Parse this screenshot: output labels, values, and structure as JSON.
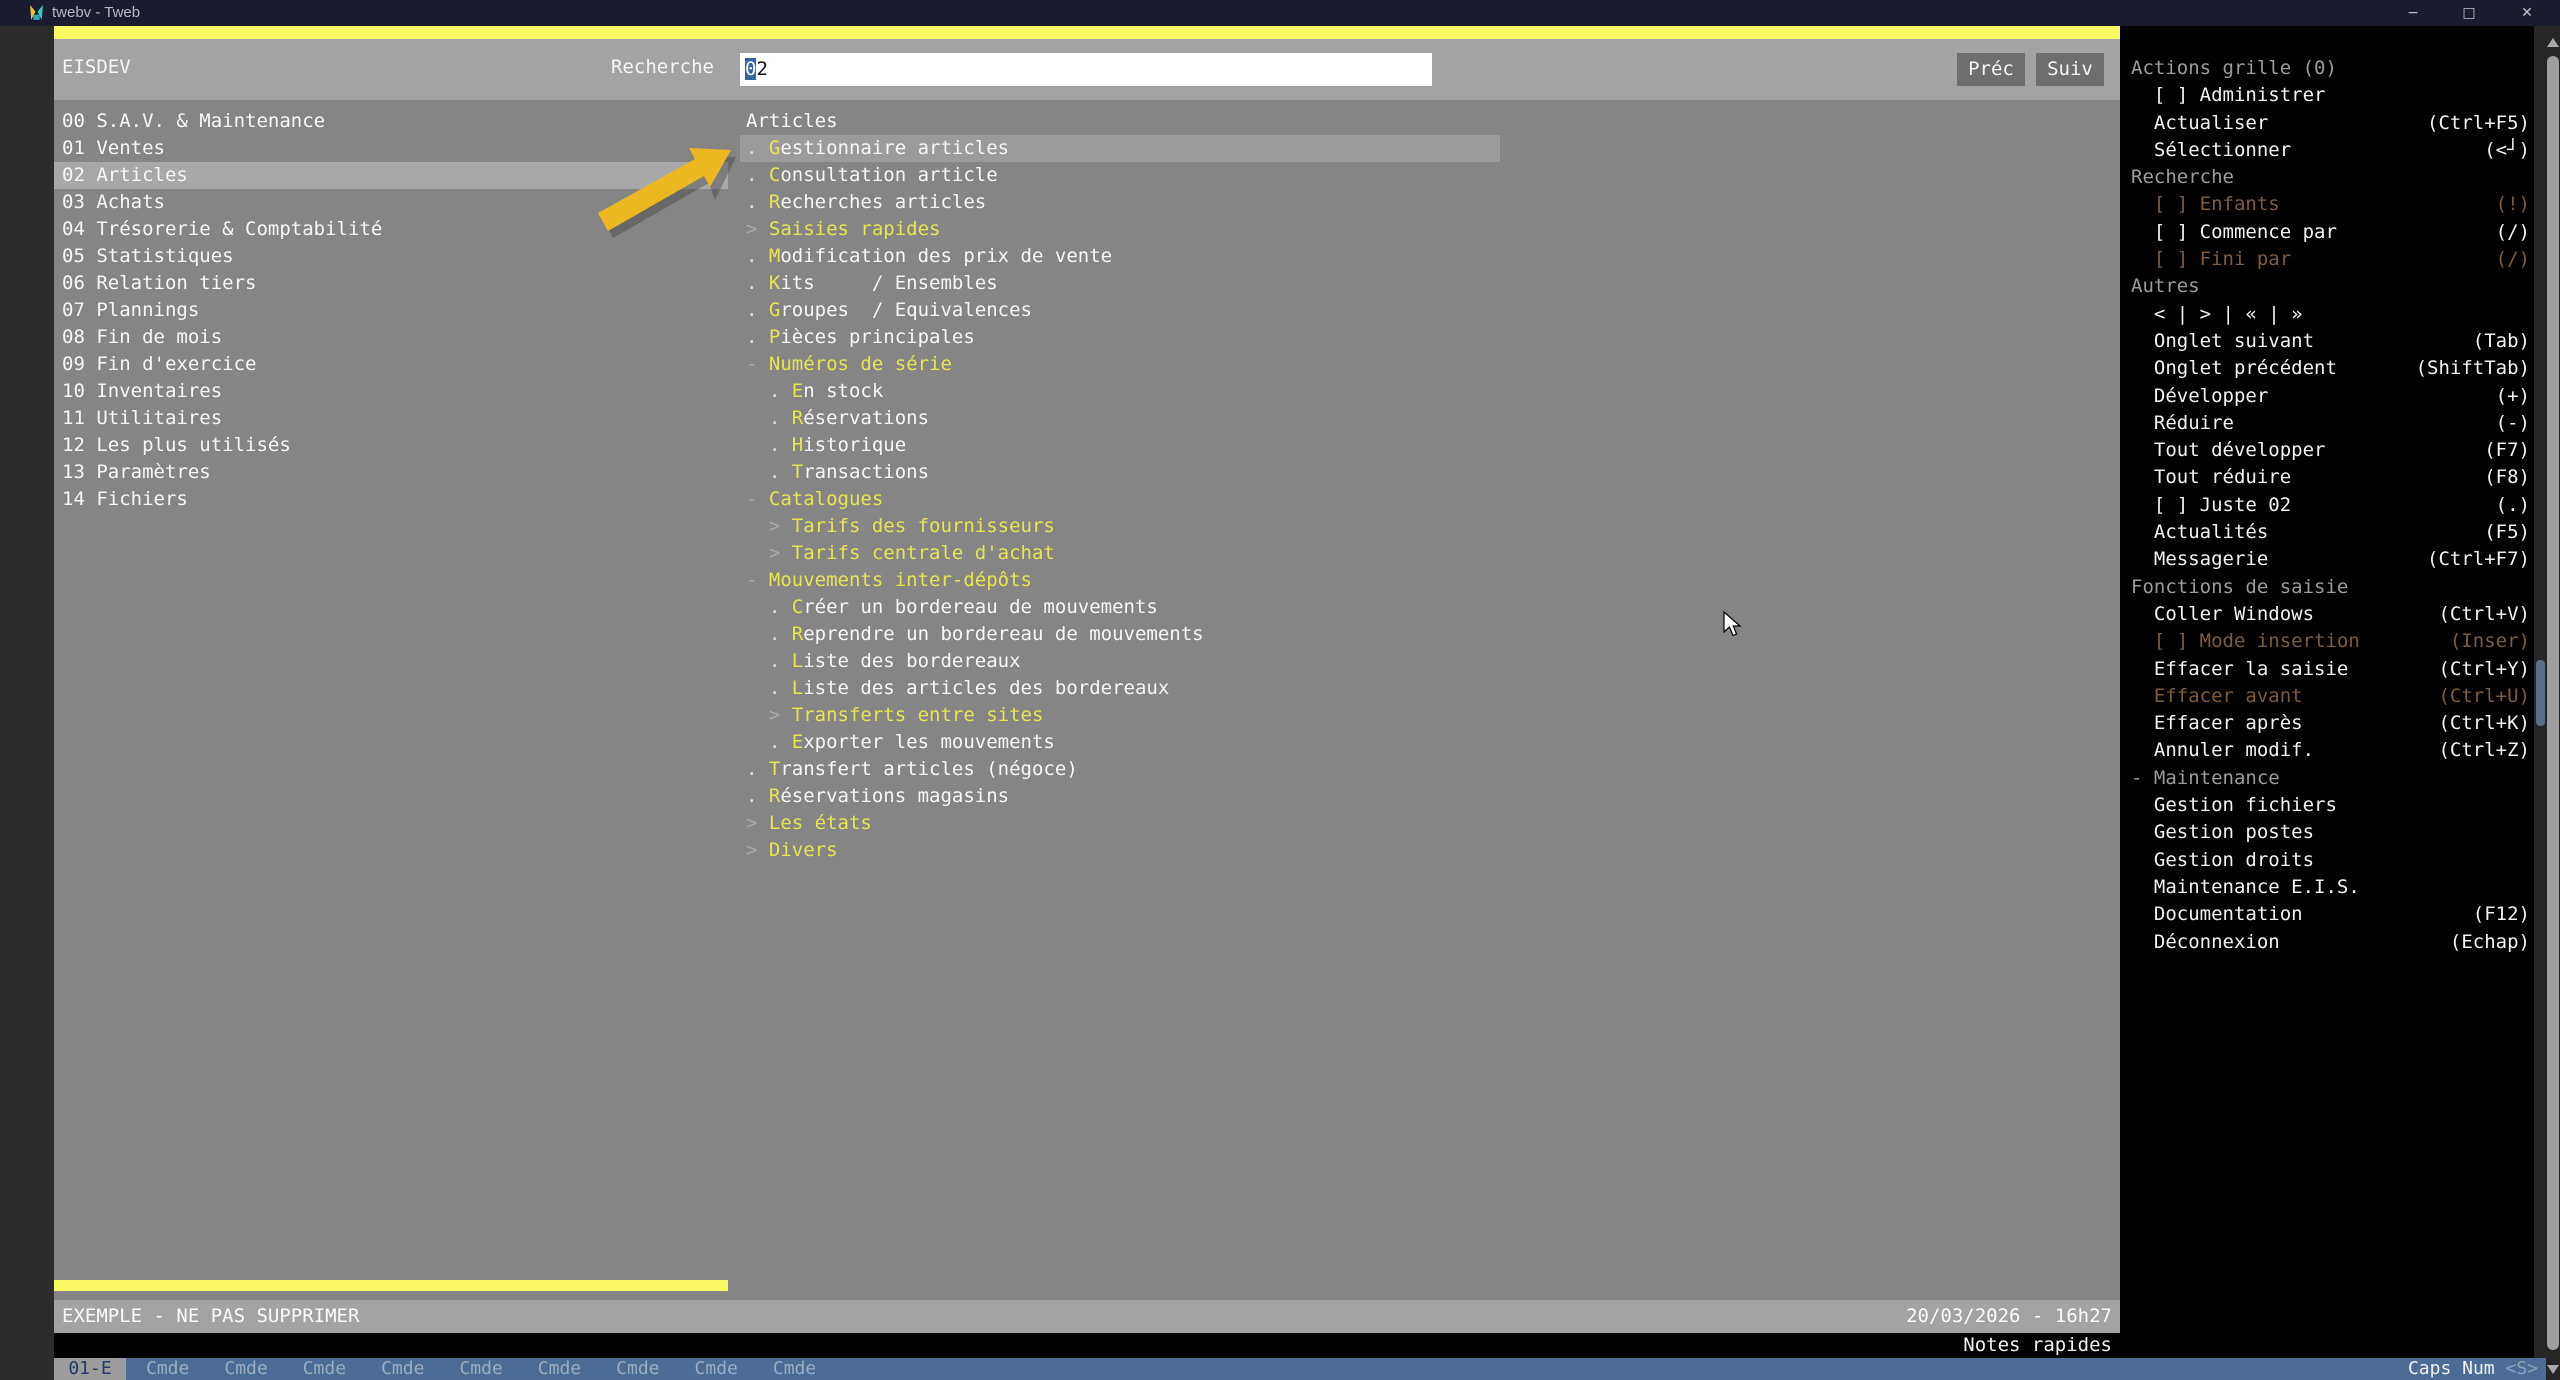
{
  "window": {
    "title": "twebv - Tweb",
    "controls": {
      "minimize": "−",
      "maximize": "□",
      "close": "✕"
    }
  },
  "colors": {
    "accent_yellow": "#f9f964",
    "menu_hotkey_yellow": "#e9e550",
    "selection_blue": "#3465a4",
    "tabbar_blue": "#4a6c96",
    "dim_brown": "#7e5c3f",
    "arrow_gold": "#ecb822",
    "sidebar_bg": "#000000"
  },
  "topbar": {
    "session": "EISDEV",
    "search_label": "Recherche",
    "search_selected": "0",
    "search_rest": "2",
    "prev_label": "Préc",
    "next_label": "Suiv"
  },
  "left_menu": {
    "items": [
      {
        "code": "00",
        "label": "S.A.V. & Maintenance",
        "selected": false
      },
      {
        "code": "01",
        "label": "Ventes",
        "selected": false
      },
      {
        "code": "02",
        "label": "Articles",
        "selected": true
      },
      {
        "code": "03",
        "label": "Achats",
        "selected": false
      },
      {
        "code": "04",
        "label": "Trésorerie & Comptabilité",
        "selected": false
      },
      {
        "code": "05",
        "label": "Statistiques",
        "selected": false
      },
      {
        "code": "06",
        "label": "Relation tiers",
        "selected": false
      },
      {
        "code": "07",
        "label": "Plannings",
        "selected": false
      },
      {
        "code": "08",
        "label": "Fin de mois",
        "selected": false
      },
      {
        "code": "09",
        "label": "Fin d'exercice",
        "selected": false
      },
      {
        "code": "10",
        "label": "Inventaires",
        "selected": false
      },
      {
        "code": "11",
        "label": "Utilitaires",
        "selected": false
      },
      {
        "code": "12",
        "label": "Les plus utilisés",
        "selected": false
      },
      {
        "code": "13",
        "label": "Paramètres",
        "selected": false
      },
      {
        "code": "14",
        "label": "Fichiers",
        "selected": false
      }
    ]
  },
  "articles_menu": {
    "title": "Articles",
    "items": [
      {
        "indent": 0,
        "prefix": ".",
        "label": "Gestionnaire articles",
        "hl": "first",
        "selected": true
      },
      {
        "indent": 0,
        "prefix": ".",
        "label": "Consultation article",
        "hl": "first",
        "selected": false
      },
      {
        "indent": 0,
        "prefix": ".",
        "label": "Recherches articles",
        "hl": "first",
        "selected": false
      },
      {
        "indent": 0,
        "prefix": ">",
        "label": "Saisies rapides",
        "hl": "all",
        "selected": false
      },
      {
        "indent": 0,
        "prefix": ".",
        "label": "Modification des prix de vente",
        "hl": "first",
        "selected": false
      },
      {
        "indent": 0,
        "prefix": ".",
        "label": "Kits     / Ensembles",
        "hl": "first",
        "selected": false
      },
      {
        "indent": 0,
        "prefix": ".",
        "label": "Groupes  / Equivalences",
        "hl": "first",
        "selected": false
      },
      {
        "indent": 0,
        "prefix": ".",
        "label": "Pièces principales",
        "hl": "first",
        "selected": false
      },
      {
        "indent": 0,
        "prefix": "-",
        "label": "Numéros de série",
        "hl": "all",
        "selected": false
      },
      {
        "indent": 1,
        "prefix": ".",
        "label": "En stock",
        "hl": "first",
        "selected": false
      },
      {
        "indent": 1,
        "prefix": ".",
        "label": "Réservations",
        "hl": "first",
        "selected": false
      },
      {
        "indent": 1,
        "prefix": ".",
        "label": "Historique",
        "hl": "first",
        "selected": false
      },
      {
        "indent": 1,
        "prefix": ".",
        "label": "Transactions",
        "hl": "first",
        "selected": false
      },
      {
        "indent": 0,
        "prefix": "-",
        "label": "Catalogues",
        "hl": "all",
        "selected": false
      },
      {
        "indent": 1,
        "prefix": ">",
        "label": "Tarifs des fournisseurs",
        "hl": "all",
        "selected": false
      },
      {
        "indent": 1,
        "prefix": ">",
        "label": "Tarifs centrale d'achat",
        "hl": "all",
        "selected": false
      },
      {
        "indent": 0,
        "prefix": "-",
        "label": "Mouvements inter-dépôts",
        "hl": "all",
        "selected": false
      },
      {
        "indent": 1,
        "prefix": ".",
        "label": "Créer un bordereau de mouvements",
        "hl": "first",
        "selected": false
      },
      {
        "indent": 1,
        "prefix": ".",
        "label": "Reprendre un bordereau de mouvements",
        "hl": "first",
        "selected": false
      },
      {
        "indent": 1,
        "prefix": ".",
        "label": "Liste des bordereaux",
        "hl": "first",
        "selected": false
      },
      {
        "indent": 1,
        "prefix": ".",
        "label": "Liste des articles des bordereaux",
        "hl": "first",
        "selected": false
      },
      {
        "indent": 1,
        "prefix": ">",
        "label": "Transferts entre sites",
        "hl": "all",
        "selected": false
      },
      {
        "indent": 1,
        "prefix": ".",
        "label": "Exporter les mouvements",
        "hl": "first",
        "selected": false
      },
      {
        "indent": 0,
        "prefix": ".",
        "label": "Transfert articles (négoce)",
        "hl": "first",
        "selected": false
      },
      {
        "indent": 0,
        "prefix": ".",
        "label": "Réservations magasins",
        "hl": "first",
        "selected": false
      },
      {
        "indent": 0,
        "prefix": ">",
        "label": "Les états",
        "hl": "all",
        "selected": false
      },
      {
        "indent": 0,
        "prefix": ">",
        "label": "Divers",
        "hl": "all",
        "selected": false
      }
    ]
  },
  "sidebar": {
    "rows": [
      {
        "label": "Actions grille (0)",
        "shortcut": "",
        "style": "header"
      },
      {
        "label": "[ ] Administrer",
        "shortcut": "",
        "style": "normal"
      },
      {
        "label": "Actualiser",
        "shortcut": "(Ctrl+F5)",
        "style": "normal"
      },
      {
        "label": "Sélectionner",
        "shortcut": "(<┘)",
        "style": "normal"
      },
      {
        "label": "Recherche",
        "shortcut": "",
        "style": "header"
      },
      {
        "label": "[ ] Enfants",
        "shortcut": "(!)",
        "style": "dim"
      },
      {
        "label": "[ ] Commence par",
        "shortcut": "(/)",
        "style": "normal"
      },
      {
        "label": "[ ] Fini par",
        "shortcut": "(/)",
        "style": "dim"
      },
      {
        "label": "Autres",
        "shortcut": "",
        "style": "header"
      },
      {
        "label": "< | > | « | »",
        "shortcut": "",
        "style": "normal"
      },
      {
        "label": "Onglet suivant",
        "shortcut": "(Tab)",
        "style": "normal"
      },
      {
        "label": "Onglet précédent",
        "shortcut": "(ShiftTab)",
        "style": "normal"
      },
      {
        "label": "Développer",
        "shortcut": "(+)",
        "style": "normal"
      },
      {
        "label": "Réduire",
        "shortcut": "(-)",
        "style": "normal"
      },
      {
        "label": "Tout développer",
        "shortcut": "(F7)",
        "style": "normal"
      },
      {
        "label": "Tout réduire",
        "shortcut": "(F8)",
        "style": "normal"
      },
      {
        "label": "[ ] Juste 02",
        "shortcut": "(.)",
        "style": "normal"
      },
      {
        "label": "Actualités",
        "shortcut": "(F5)",
        "style": "normal"
      },
      {
        "label": "Messagerie",
        "shortcut": "(Ctrl+F7)",
        "style": "normal"
      },
      {
        "label": "Fonctions de saisie",
        "shortcut": "",
        "style": "header"
      },
      {
        "label": "Coller Windows",
        "shortcut": "(Ctrl+V)",
        "style": "normal"
      },
      {
        "label": "[ ] Mode insertion",
        "shortcut": "(Inser)",
        "style": "dim"
      },
      {
        "label": "Effacer la saisie",
        "shortcut": "(Ctrl+Y)",
        "style": "normal"
      },
      {
        "label": "Effacer avant",
        "shortcut": "(Ctrl+U)",
        "style": "dim"
      },
      {
        "label": "Effacer après",
        "shortcut": "(Ctrl+K)",
        "style": "normal"
      },
      {
        "label": "Annuler modif.",
        "shortcut": "(Ctrl+Z)",
        "style": "normal"
      },
      {
        "label": "- Maintenance",
        "shortcut": "",
        "style": "header"
      },
      {
        "label": "Gestion fichiers",
        "shortcut": "",
        "style": "normal"
      },
      {
        "label": "Gestion postes",
        "shortcut": "",
        "style": "normal"
      },
      {
        "label": "Gestion droits",
        "shortcut": "",
        "style": "normal"
      },
      {
        "label": "Maintenance E.I.S.",
        "shortcut": "",
        "style": "normal"
      },
      {
        "label": "Documentation",
        "shortcut": "(F12)",
        "style": "normal"
      },
      {
        "label": "Déconnexion",
        "shortcut": "(Echap)",
        "style": "normal"
      }
    ]
  },
  "statusbar": {
    "example": "EXEMPLE - NE PAS SUPPRIMER",
    "datetime": "20/03/2026 - 16h27",
    "notes": "Notes rapides"
  },
  "tabbar": {
    "active": "01-E",
    "tabs": [
      "Cmde",
      "Cmde",
      "Cmde",
      "Cmde",
      "Cmde",
      "Cmde",
      "Cmde",
      "Cmde",
      "Cmde"
    ],
    "caps": "Caps Num",
    "caps_mode": "<S>"
  }
}
